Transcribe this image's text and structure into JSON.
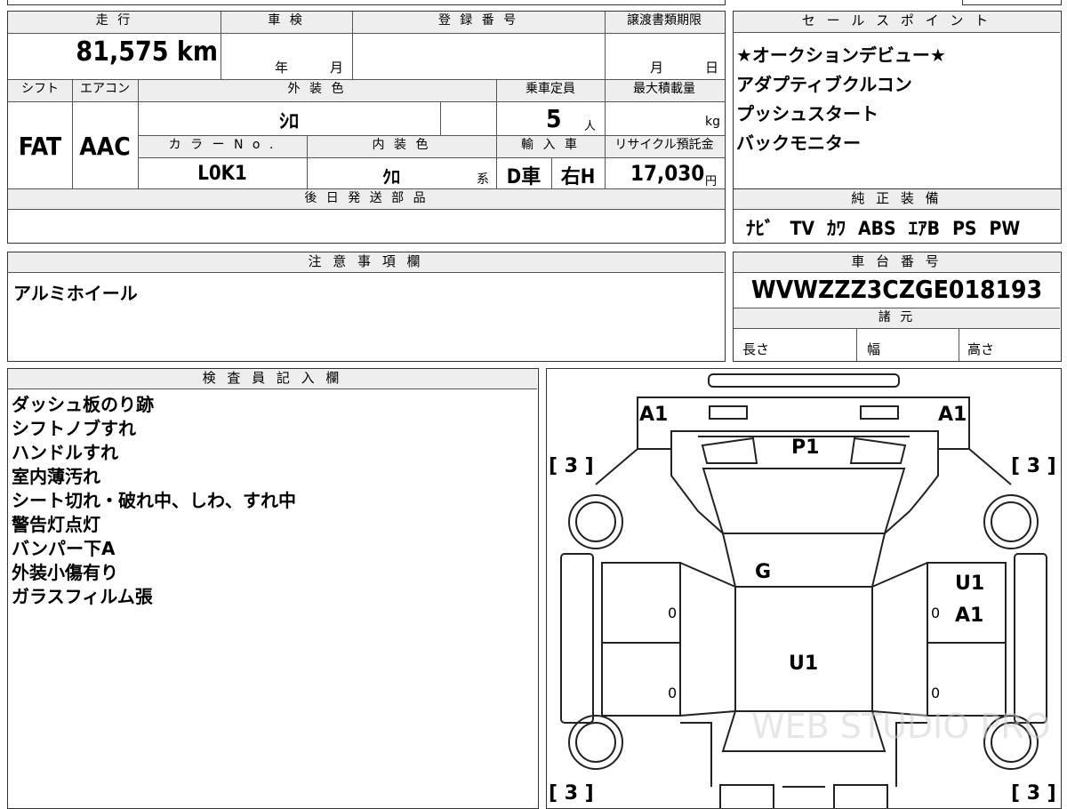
{
  "top": {
    "headers": {
      "mileage": "走 行",
      "inspection": "車 検",
      "registration": "登 録 番 号",
      "deadline": "譲渡書類期限"
    },
    "mileage": "81,575 km",
    "inspection_year": "年",
    "inspection_month": "月",
    "deadline_month": "月",
    "deadline_day": "日"
  },
  "spec_headers": {
    "shift": "シフト",
    "aircon": "エアコン",
    "exterior": "外 装 色",
    "capacity": "乗車定員",
    "load": "最大積載量",
    "color_no": "カ ラ ー N o .",
    "interior": "内 装 色",
    "import": "輸 入 車",
    "recycle": "リサイクル預託金"
  },
  "spec": {
    "shift": "FAT",
    "aircon": "AAC",
    "exterior": "ｼﾛ",
    "capacity": "5",
    "capacity_unit": "人",
    "load_unit": "kg",
    "color_no": "L0K1",
    "interior": "ｸﾛ",
    "interior_suffix": "系",
    "import_type": "D車",
    "handle": "右H",
    "recycle": "17,030",
    "recycle_unit": "円"
  },
  "later_parts": {
    "header": "後 日 発 送 部 品"
  },
  "sales": {
    "header": "セ ー ル ス ポ イ ン ト",
    "items": [
      "★オークションデビュー★",
      "アダプティブクルコン",
      "プッシュスタート",
      "バックモニター"
    ]
  },
  "equipment": {
    "header": "純 正 装 備",
    "items": [
      "ﾅﾋﾞ",
      "TV",
      "ｶﾜ",
      "ABS",
      "ｴｱB",
      "PS",
      "PW"
    ]
  },
  "notes": {
    "header": "注 意 事 項 欄",
    "text": "アルミホイール"
  },
  "chassis": {
    "header": "車 台 番 号",
    "number": "WVWZZZ3CZGE018193"
  },
  "dims": {
    "header": "諸 元",
    "length": "長さ",
    "width": "幅",
    "height": "高さ"
  },
  "inspector": {
    "header": "検 査 員 記 入 欄",
    "items": [
      "ダッシュ板のり跡",
      "シフトノブすれ",
      "ハンドルすれ",
      "室内薄汚れ",
      "シート切れ・破れ中、しわ、すれ中",
      "警告灯点灯",
      "バンパー下A",
      "外装小傷有り",
      "ガラスフィルム張"
    ]
  },
  "diagram": {
    "labels": {
      "a1_left": "A1",
      "a1_right": "A1",
      "p1": "P1",
      "g": "G",
      "u1_right": "U1",
      "a1_side": "A1",
      "u1_center": "U1"
    },
    "tire_tl": "[ 3 ]",
    "tire_tr": "[ 3 ]",
    "tire_bl": "[ 3 ]",
    "tire_br": "[ 3 ]",
    "zero1": "0",
    "zero2": "0",
    "zero3": "0",
    "zero4": "0",
    "watermark": "WEB STUDIO PRO"
  }
}
